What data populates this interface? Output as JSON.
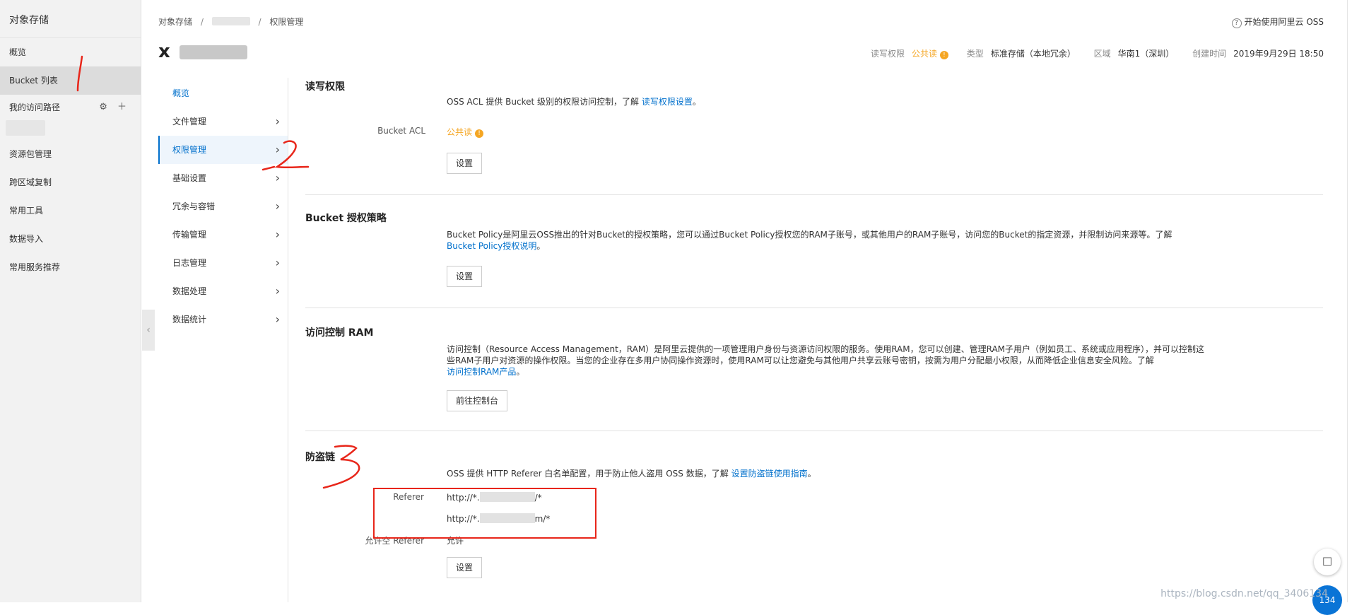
{
  "left_nav": {
    "title": "对象存储",
    "items": [
      {
        "label": "概览"
      },
      {
        "label": "Bucket 列表"
      },
      {
        "label": "我的访问路径"
      },
      {
        "label": "资源包管理"
      },
      {
        "label": "跨区域复制"
      },
      {
        "label": "常用工具"
      },
      {
        "label": "数据导入"
      },
      {
        "label": "常用服务推荐"
      }
    ],
    "tool_icons": [
      "gear-icon",
      "plus-icon"
    ]
  },
  "breadcrumb": {
    "root": "对象存储",
    "separator": "/",
    "current": "权限管理"
  },
  "top_right": {
    "label": "开始使用阿里云 OSS",
    "icon": "question-circle-icon"
  },
  "bucket": {
    "name_initial": "x",
    "meta": {
      "acl_label": "读写权限",
      "acl_value": "公共读",
      "type_label": "类型",
      "type_value": "标准存储（本地冗余）",
      "region_label": "区域",
      "region_value": "华南1（深圳）",
      "created_label": "创建时间",
      "created_value": "2019年9月29日 18:50"
    }
  },
  "sub_nav": {
    "items": [
      {
        "label": "概览"
      },
      {
        "label": "文件管理"
      },
      {
        "label": "权限管理"
      },
      {
        "label": "基础设置"
      },
      {
        "label": "冗余与容错"
      },
      {
        "label": "传输管理"
      },
      {
        "label": "日志管理"
      },
      {
        "label": "数据处理"
      },
      {
        "label": "数据统计"
      }
    ]
  },
  "sections": {
    "rw": {
      "title": "读写权限",
      "desc_prefix": "OSS ACL 提供 Bucket 级别的权限访问控制，了解",
      "desc_link": "读写权限设置",
      "desc_suffix": "。",
      "acl_label": "Bucket ACL",
      "acl_value": "公共读",
      "button": "设置"
    },
    "policy": {
      "title": "Bucket 授权策略",
      "desc": "Bucket Policy是阿里云OSS推出的针对Bucket的授权策略，您可以通过Bucket Policy授权您的RAM子账号，或其他用户的RAM子账号，访问您的Bucket的指定资源，并限制访问来源等。了解",
      "desc_link": "Bucket Policy授权说明",
      "desc_suffix": "。",
      "button": "设置"
    },
    "ram": {
      "title": "访问控制 RAM",
      "desc_line1": "访问控制（Resource Access Management，RAM）是阿里云提供的一项管理用户身份与资源访问权限的服务。使用RAM，您可以创建、管理RAM子用户（例如员工、系统或应用程序），并可以控制这",
      "desc_line2": "些RAM子用户对资源的操作权限。当您的企业存在多用户协同操作资源时，使用RAM可以让您避免与其他用户共享云账号密钥，按需为用户分配最小权限，从而降低企业信息安全风险。了解",
      "desc_link": "访问控制RAM产品",
      "desc_suffix": "。",
      "button": "前往控制台"
    },
    "referer": {
      "title": "防盗链",
      "desc_prefix": "OSS 提供 HTTP Referer 白名单配置，用于防止他人盗用 OSS 数据，了解",
      "desc_link": "设置防盗链使用指南",
      "desc_suffix": "。",
      "referer_label": "Referer",
      "referer_1_prefix": "http://*.",
      "referer_1_suffix": "/*",
      "referer_2_prefix": "http://*.",
      "referer_2_suffix": "m/*",
      "allow_empty_label": "允许空 Referer",
      "allow_empty_value": "允许",
      "button": "设置"
    }
  },
  "annotations": [
    "1",
    "2",
    "3"
  ],
  "watermark": "https://blog.csdn.net/qq_3406134",
  "float_blue_text": "134",
  "colors": {
    "accent_orange": "#ff6a00",
    "link_blue": "#0070cc",
    "warning_orange": "#f5a623",
    "annotation_red": "#e8261a"
  }
}
